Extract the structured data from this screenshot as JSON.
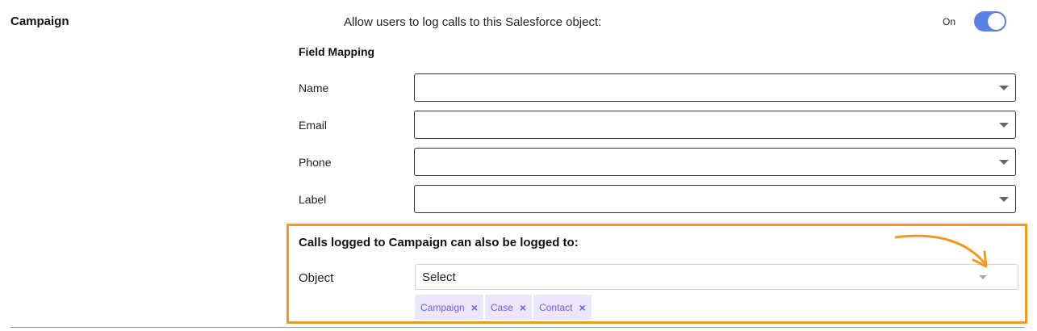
{
  "section": {
    "title": "Campaign"
  },
  "allow": {
    "label": "Allow users to log calls to this Salesforce object:",
    "state": "On"
  },
  "mapping": {
    "title": "Field Mapping",
    "fields": [
      {
        "label": "Name",
        "value": ""
      },
      {
        "label": "Email",
        "value": ""
      },
      {
        "label": "Phone",
        "value": ""
      },
      {
        "label": "Label",
        "value": ""
      }
    ]
  },
  "also": {
    "title": "Calls logged to Campaign can also be logged to:",
    "object_label": "Object",
    "select_placeholder": "Select",
    "tags": [
      {
        "label": "Campaign",
        "remove": "×"
      },
      {
        "label": "Case",
        "remove": "×"
      },
      {
        "label": "Contact",
        "remove": "×"
      }
    ]
  },
  "colors": {
    "toggle_on": "#5a7fe6",
    "highlight": "#f39a1e",
    "tag_bg": "#ece7fb",
    "tag_text": "#7a5ae0"
  },
  "icons": {
    "dropdown": "caret-down-icon",
    "annotation": "curved-arrow-icon",
    "remove": "close-icon"
  }
}
